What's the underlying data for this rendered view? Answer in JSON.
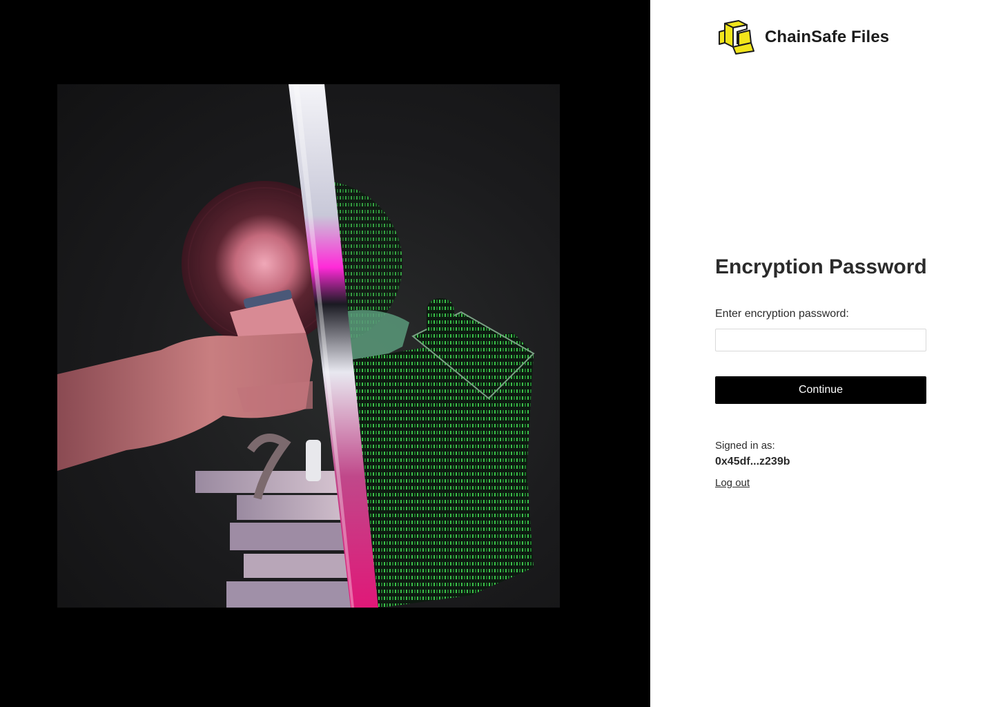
{
  "brand": {
    "name": "ChainSafe Files",
    "logo_icon": "chainsafe-logo-icon",
    "accent_color": "#f2e51b"
  },
  "hero": {
    "image_icon": "landing-illustration"
  },
  "form": {
    "title": "Encryption Password",
    "password_label": "Enter encryption password:",
    "password_value": "",
    "continue_label": "Continue"
  },
  "account": {
    "signed_in_label": "Signed in as:",
    "address": "0x45df...z239b",
    "logout_label": "Log out"
  }
}
